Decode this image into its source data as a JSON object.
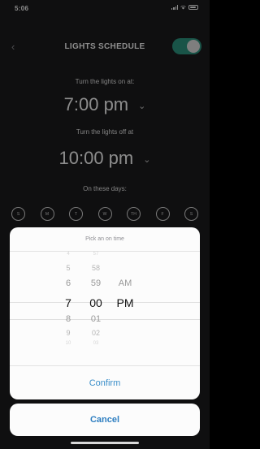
{
  "status_bar": {
    "time": "5:06"
  },
  "nav": {
    "title": "LIGHTS SCHEDULE",
    "toggle_on": true
  },
  "schedule": {
    "on_label": "Turn the lights on at:",
    "on_time": "7:00 pm",
    "off_label": "Turn the lights off at",
    "off_time": "10:00 pm",
    "days_label": "On these days:",
    "days": [
      "S",
      "M",
      "T",
      "W",
      "TH",
      "F",
      "S"
    ]
  },
  "picker": {
    "title": "Pick an on time",
    "hours": [
      "4",
      "5",
      "6",
      "7",
      "8",
      "9",
      "10"
    ],
    "minutes": [
      "57",
      "58",
      "59",
      "00",
      "01",
      "02",
      "03"
    ],
    "ampm": [
      "AM",
      "PM"
    ],
    "confirm_label": "Confirm"
  },
  "cancel_label": "Cancel",
  "colors": {
    "accent": "#3a8ec9",
    "toggle": "#2f9a84",
    "background": "#1c1c1e"
  }
}
